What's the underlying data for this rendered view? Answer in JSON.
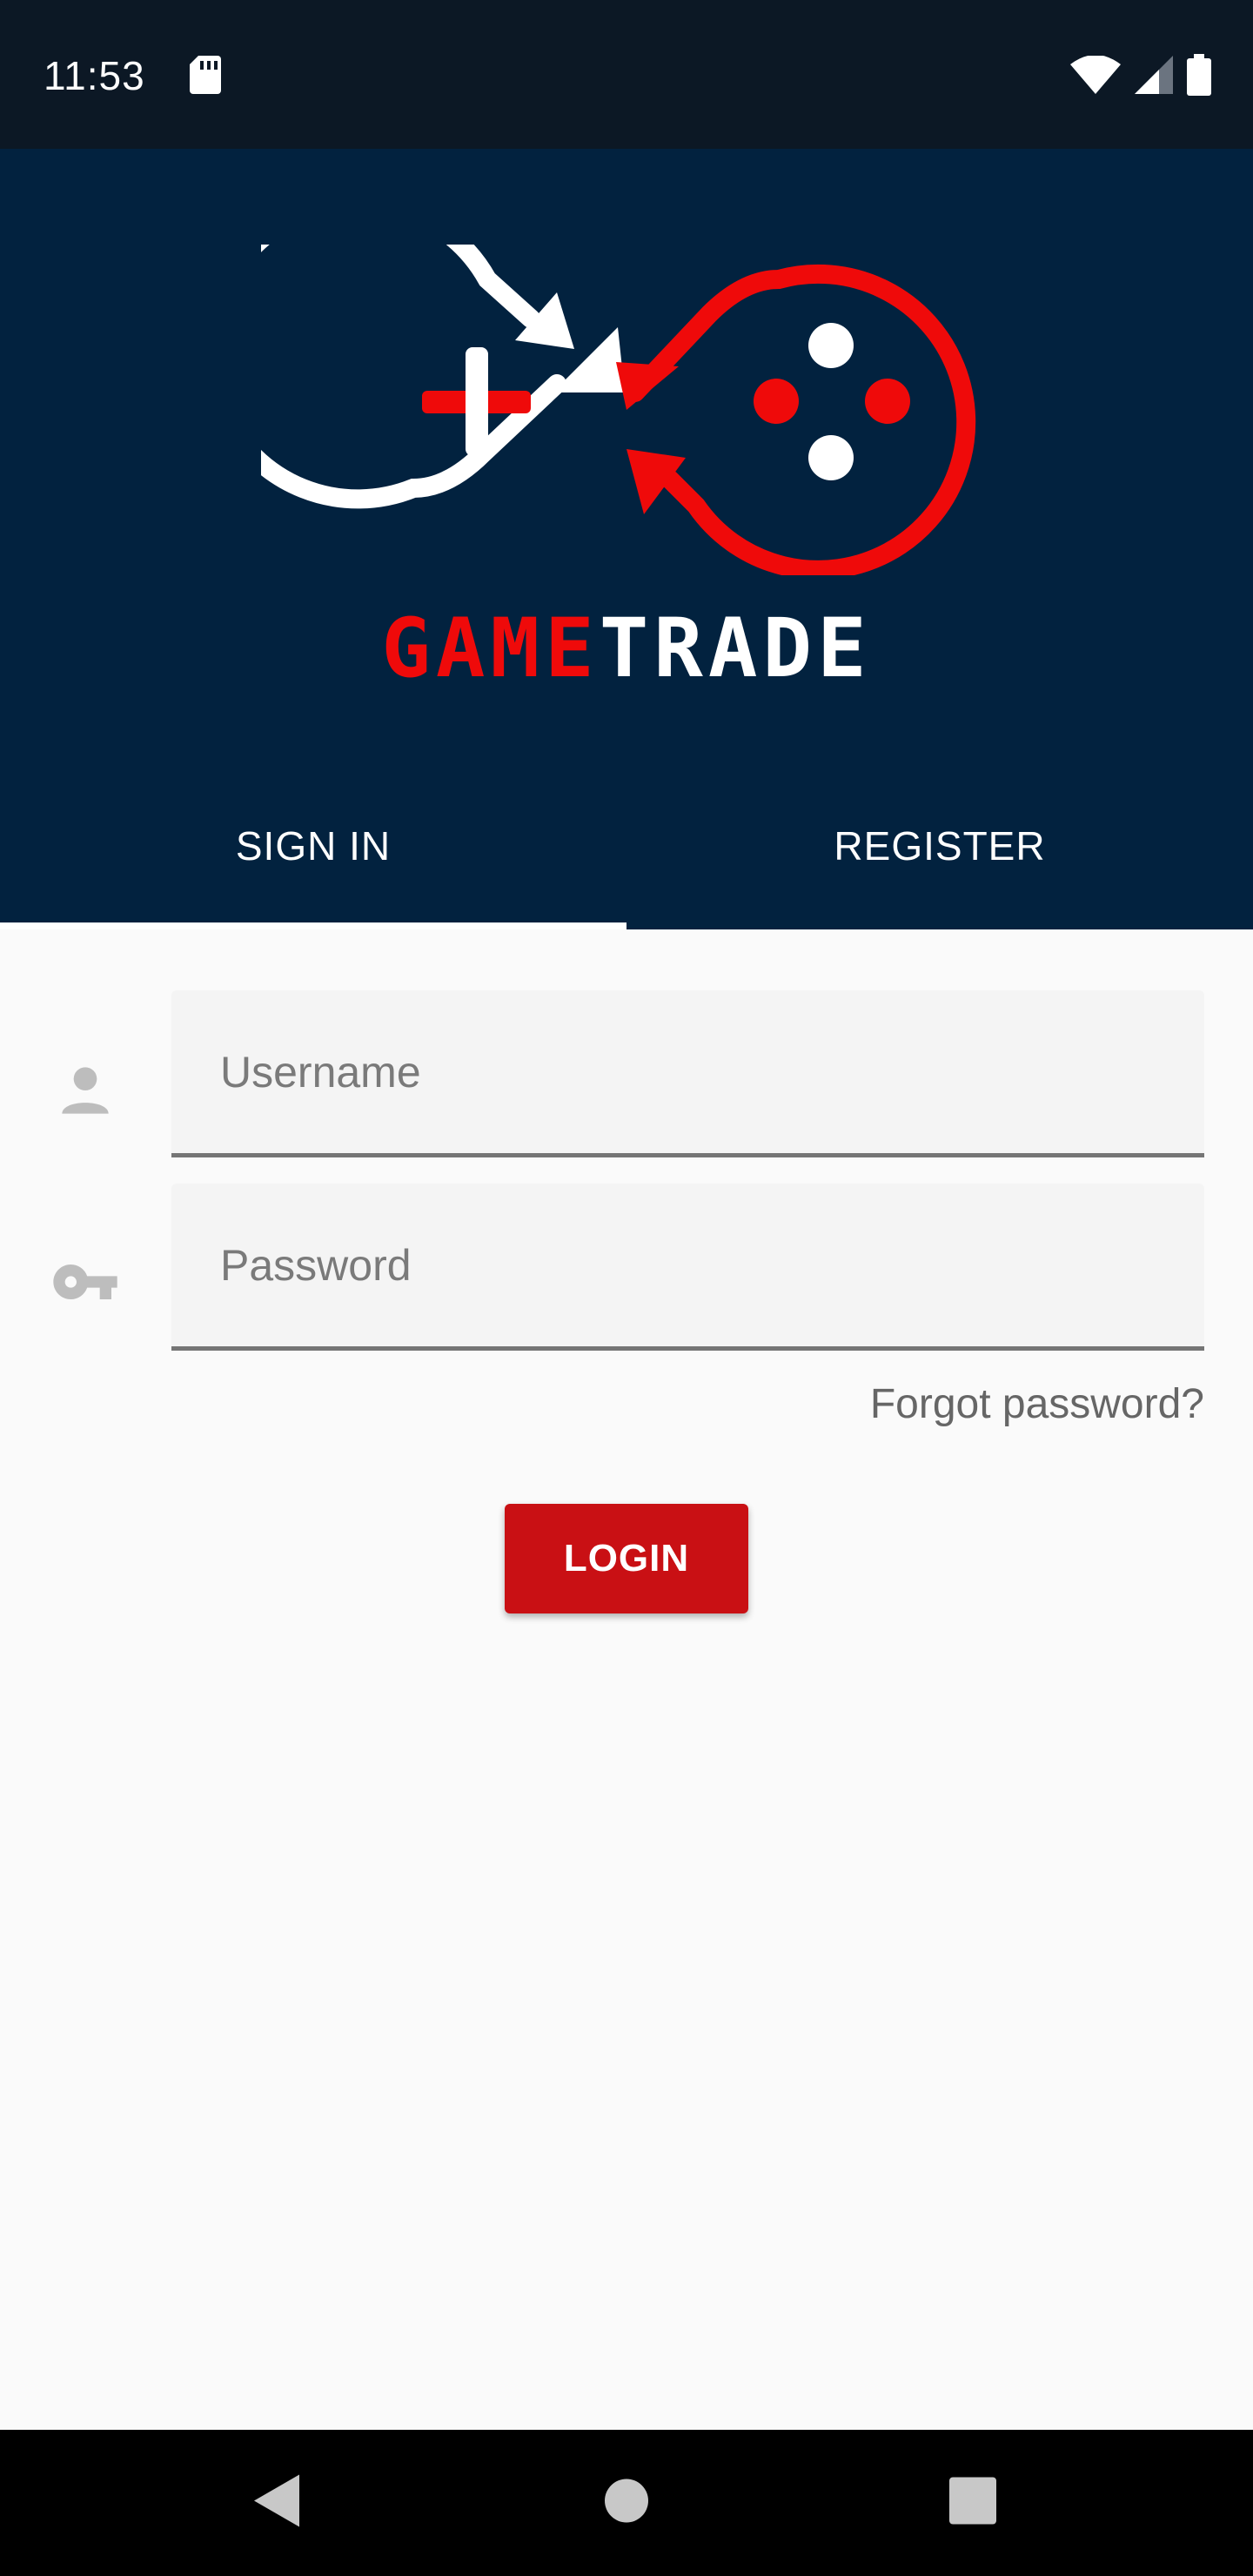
{
  "status_bar": {
    "time": "11:53",
    "icons": [
      "sd-card-icon",
      "wifi-icon",
      "cellular-signal-icon",
      "battery-icon"
    ]
  },
  "brand": {
    "part1": "GAME",
    "part2": "TRADE",
    "colors": {
      "game": "#ef0a0a",
      "trade": "#ffffff",
      "header_bg": "#02223f"
    }
  },
  "tabs": [
    {
      "label": "SIGN IN",
      "active": true
    },
    {
      "label": "REGISTER",
      "active": false
    }
  ],
  "form": {
    "username": {
      "placeholder": "Username",
      "value": "",
      "icon": "person-icon"
    },
    "password": {
      "placeholder": "Password",
      "value": "",
      "icon": "key-icon"
    },
    "forgot_label": "Forgot password?",
    "login_label": "LOGIN",
    "accent": "#c91014"
  },
  "nav_bar": {
    "icons": [
      "back-icon",
      "home-icon",
      "recents-icon"
    ]
  }
}
